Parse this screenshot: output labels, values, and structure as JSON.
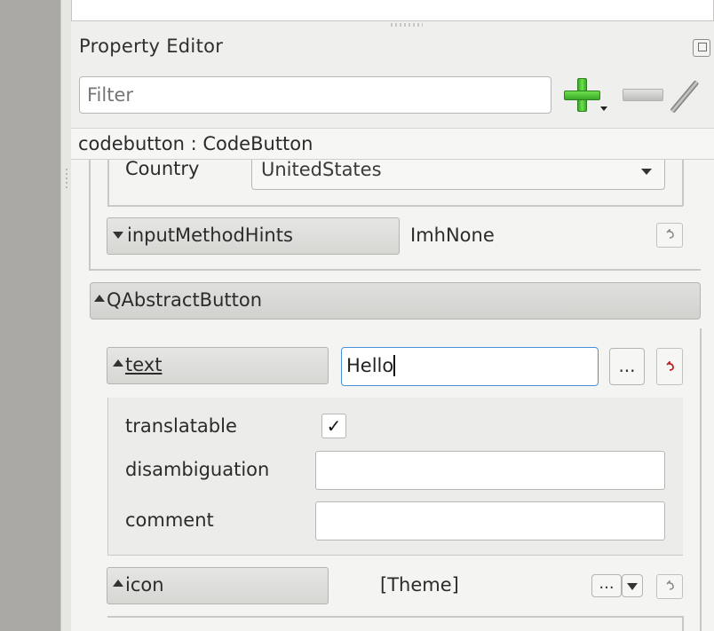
{
  "panel": {
    "title": "Property Editor",
    "filter_placeholder": "Filter"
  },
  "toolbar": {
    "add_icon": "plus-icon",
    "remove_icon": "minus-icon",
    "configure_icon": "wrench-icon",
    "float_icon": "undock-icon"
  },
  "object": {
    "label": "codebutton : CodeButton"
  },
  "properties": {
    "country": {
      "label": "Country",
      "value": "UnitedStates"
    },
    "input_method_hints": {
      "label": "inputMethodHints",
      "value": "ImhNone"
    },
    "qabstractbutton": {
      "label": "QAbstractButton"
    },
    "text": {
      "label": "text",
      "value": "Hello",
      "more_label": "...",
      "translatable": {
        "label": "translatable",
        "checked": true,
        "mark": "✓"
      },
      "disambiguation": {
        "label": "disambiguation",
        "value": ""
      },
      "comment": {
        "label": "comment",
        "value": ""
      }
    },
    "icon": {
      "label": "icon",
      "value": "[Theme]",
      "more_label": "..."
    }
  },
  "colors": {
    "add_green": "#3aa82a",
    "reset_active_red": "#c02020",
    "focus_blue": "#4a90d9"
  }
}
